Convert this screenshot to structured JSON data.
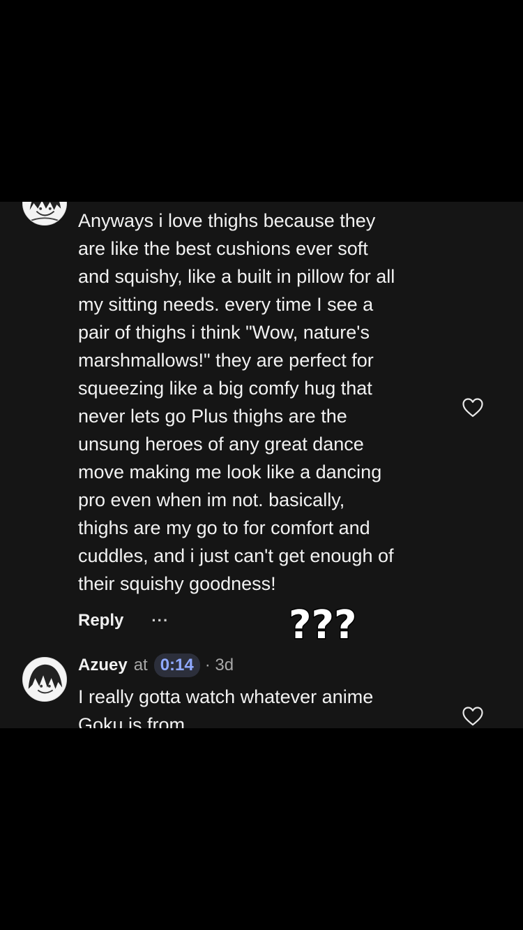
{
  "comments": [
    {
      "text": "Anyways i love thighs because they\nare like the best cushions ever soft\nand squishy, like a built in pillow for all\nmy sitting needs. every time I see a\npair of thighs i think \"Wow, nature's\nmarshmallows!\" they are perfect for\nsqueezing like a big comfy hug that\nnever lets go Plus thighs are the\nunsung heroes of any great dance\nmove making me look like a dancing\npro even when im not. basically,\nthighs are my go to for comfort and\ncuddles, and i just can't get enough of\ntheir squishy goodness!",
      "reply_label": "Reply",
      "more_label": "···",
      "sticker_text": "???"
    },
    {
      "username": "Azuey",
      "at_label": "at",
      "timestamp": "0:14",
      "age": "· 3d",
      "text": "I really gotta watch whatever anime\nGoku is from"
    }
  ],
  "icons": {
    "avatar": "anime-avatar-icon",
    "like": "heart-outline-icon",
    "sticker": "question-marks-sticker"
  },
  "colors": {
    "background": "#000000",
    "panel": "#151515",
    "text": "#f2f2f2",
    "timestamp": "#8fa9ff",
    "timestamp_bg": "#2c2f3b"
  }
}
